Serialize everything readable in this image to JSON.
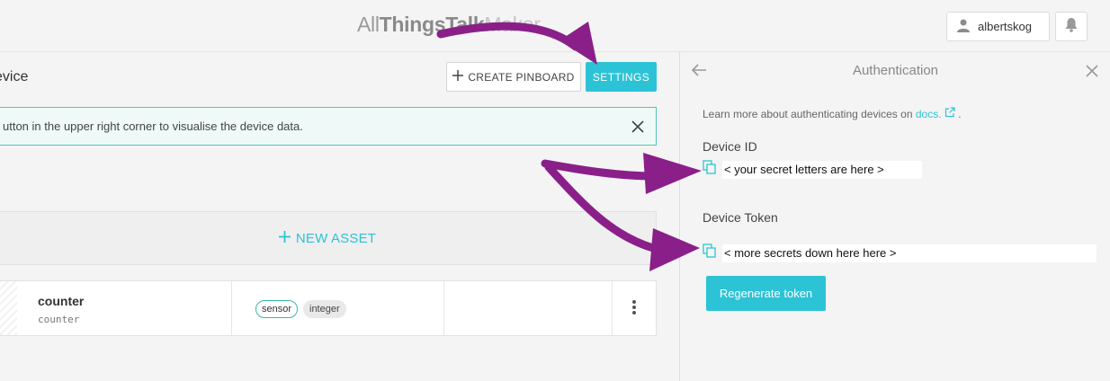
{
  "header": {
    "logo_part1": "All",
    "logo_part2": "ThingsTalk",
    "logo_part3": "Maker",
    "username": "albertskog"
  },
  "device": {
    "title": "evice",
    "create_pinboard_label": "CREATE PINBOARD",
    "settings_label": "SETTINGS",
    "banner_text": "utton in the upper right corner to visualise the device data.",
    "new_asset_label": "NEW ASSET"
  },
  "assets": [
    {
      "name": "counter",
      "id": "counter",
      "kind": "sensor",
      "type": "integer"
    }
  ],
  "panel": {
    "title": "Authentication",
    "learn_text": "Learn more about authenticating devices on",
    "learn_link": "docs.",
    "learn_suffix": ".",
    "device_id_label": "Device ID",
    "device_id_value": "< your secret letters are here >",
    "device_token_label": "Device Token",
    "device_token_value": "< more secrets down here here >",
    "regenerate_label": "Regenerate token"
  },
  "colors": {
    "accent": "#2cc3d6",
    "annotation_arrow": "#8a1f8a",
    "banner_border": "#4ec6b6"
  }
}
